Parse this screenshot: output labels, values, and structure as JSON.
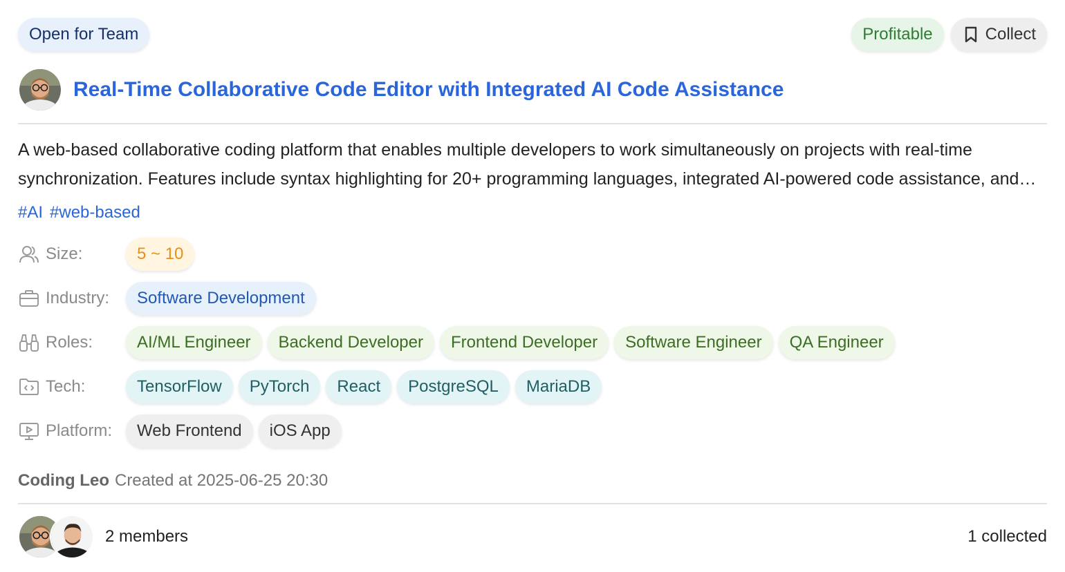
{
  "badges": {
    "open": "Open for Team",
    "profitable": "Profitable",
    "collect": "Collect"
  },
  "project": {
    "title": "Real-Time Collaborative Code Editor with Integrated AI Code Assistance",
    "description": "A web-based collaborative coding platform that enables multiple developers to work simultaneously on projects with real-time synchronization. Features include syntax highlighting for 20+ programming languages, integrated AI-powered code assistance, and more.",
    "tags": [
      "#AI",
      "#web-based"
    ]
  },
  "attributes": {
    "size": {
      "label": "Size:",
      "icon": "users-icon",
      "values": [
        "5 ~ 10"
      ]
    },
    "industry": {
      "label": "Industry:",
      "icon": "briefcase-icon",
      "values": [
        "Software Development"
      ]
    },
    "roles": {
      "label": "Roles:",
      "icon": "binoculars-icon",
      "values": [
        "AI/ML Engineer",
        "Backend Developer",
        "Frontend Developer",
        "Software Engineer",
        "QA Engineer"
      ]
    },
    "tech": {
      "label": "Tech:",
      "icon": "code-folder-icon",
      "values": [
        "TensorFlow",
        "PyTorch",
        "React",
        "PostgreSQL",
        "MariaDB"
      ]
    },
    "platform": {
      "label": "Platform:",
      "icon": "monitor-play-icon",
      "values": [
        "Web Frontend",
        "iOS App"
      ]
    }
  },
  "meta": {
    "author": "Coding Leo",
    "created": "Created at 2025-06-25 20:30"
  },
  "footer": {
    "members": "2 members",
    "collected": "1 collected"
  },
  "colors": {
    "title": "#2a66d9",
    "size_chip": "#e6901a",
    "industry_chip": "#2257b3",
    "roles_chip": "#3b6e23",
    "tech_chip": "#1f5f64"
  }
}
